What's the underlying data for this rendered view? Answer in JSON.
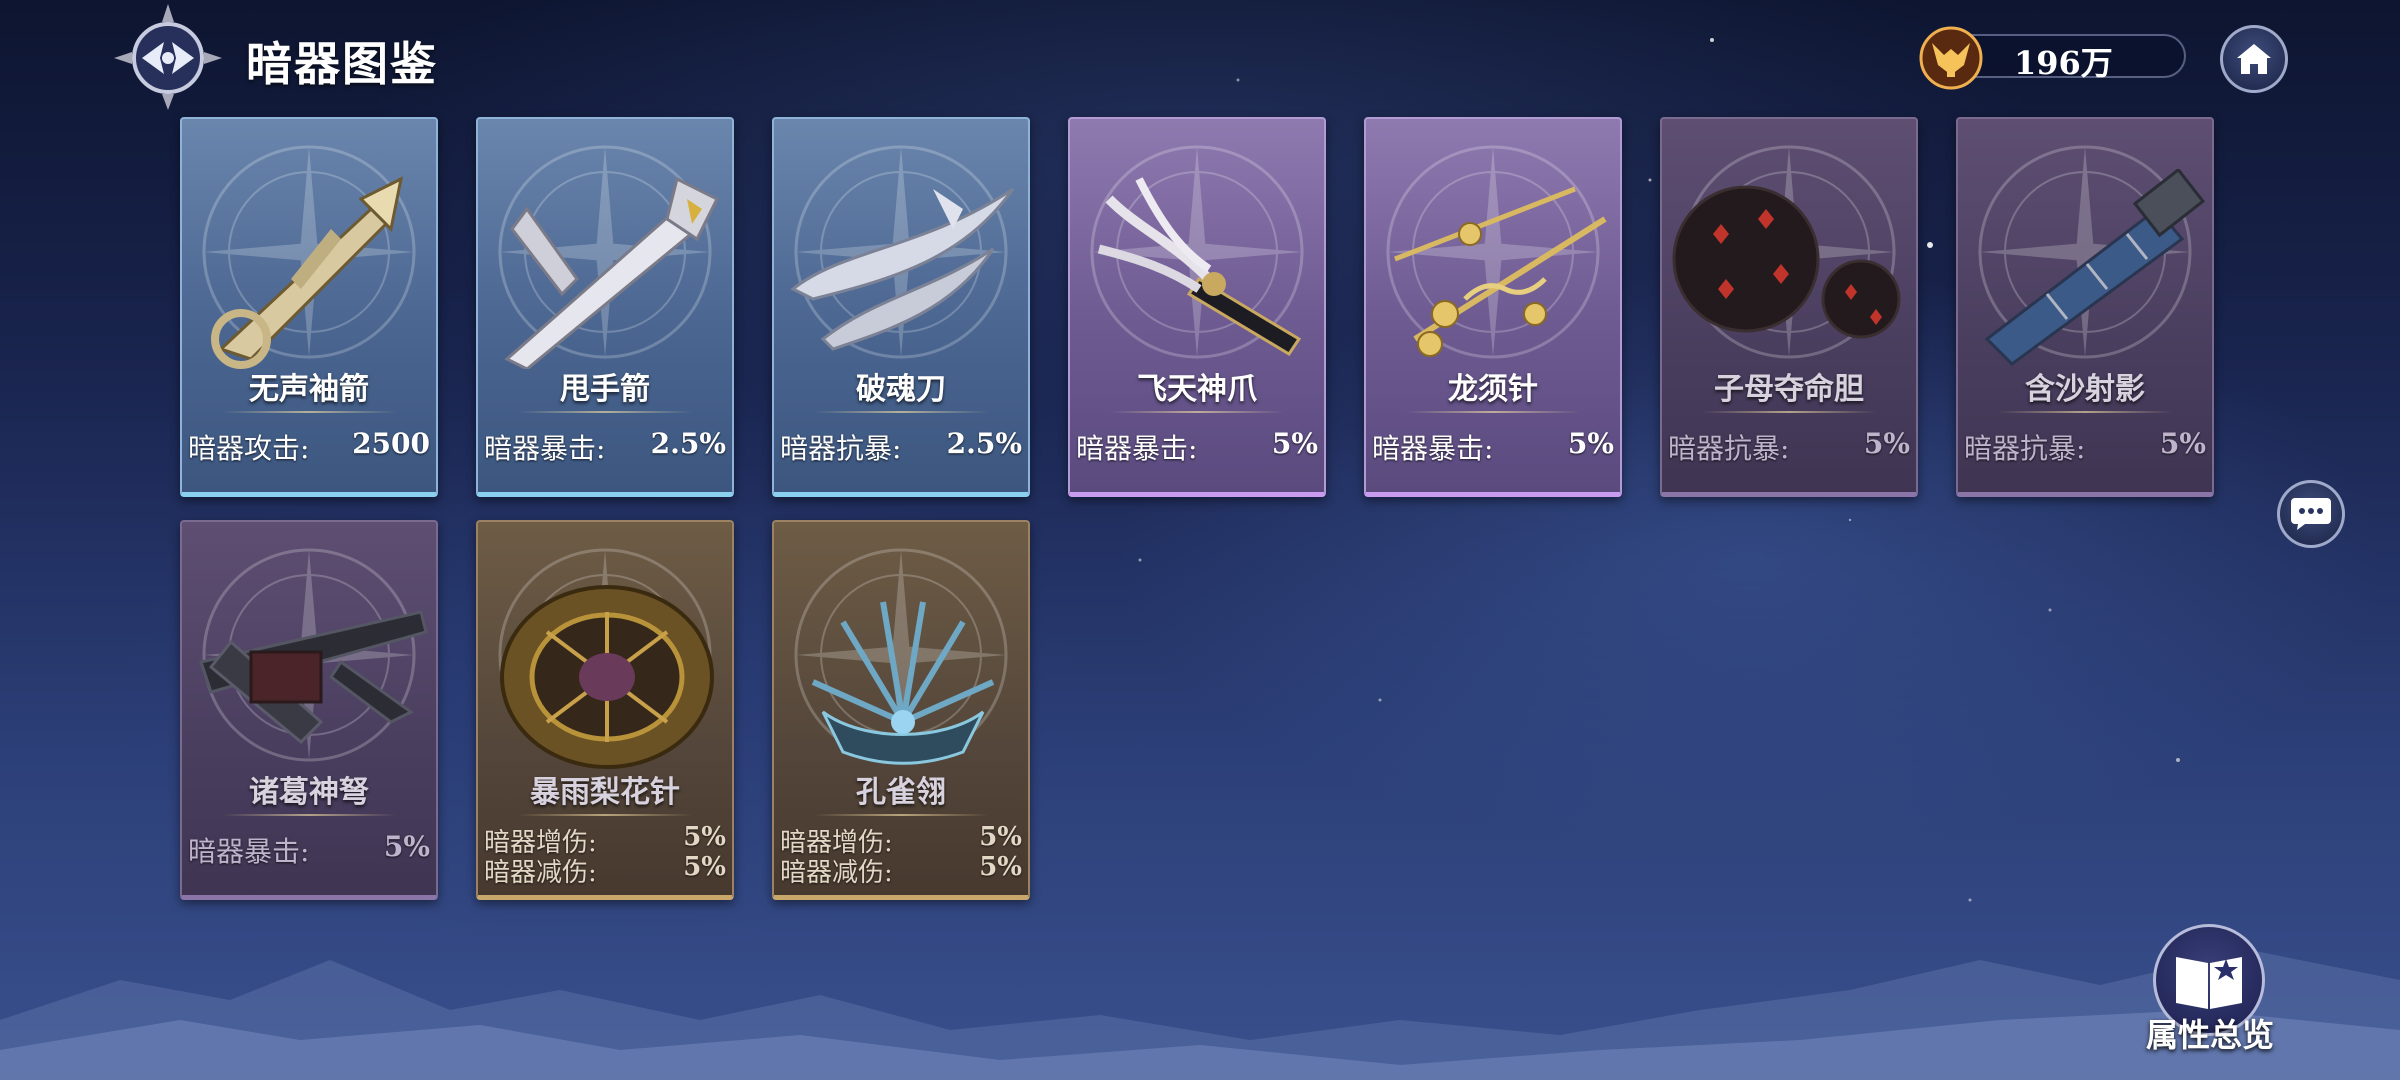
{
  "header": {
    "title": "暗器图鉴",
    "currency_value": "196万"
  },
  "cards": [
    {
      "name": "无声袖箭",
      "stats": [
        {
          "label": "暗器攻击:",
          "value": "2500"
        }
      ],
      "rarity": "blue"
    },
    {
      "name": "甩手箭",
      "stats": [
        {
          "label": "暗器暴击:",
          "value": "2.5%"
        }
      ],
      "rarity": "blue"
    },
    {
      "name": "破魂刀",
      "stats": [
        {
          "label": "暗器抗暴:",
          "value": "2.5%"
        }
      ],
      "rarity": "blue"
    },
    {
      "name": "飞天神爪",
      "stats": [
        {
          "label": "暗器暴击:",
          "value": "5%"
        }
      ],
      "rarity": "purple"
    },
    {
      "name": "龙须针",
      "stats": [
        {
          "label": "暗器暴击:",
          "value": "5%"
        }
      ],
      "rarity": "purple"
    },
    {
      "name": "子母夺命胆",
      "stats": [
        {
          "label": "暗器抗暴:",
          "value": "5%"
        }
      ],
      "rarity": "dim"
    },
    {
      "name": "含沙射影",
      "stats": [
        {
          "label": "暗器抗暴:",
          "value": "5%"
        }
      ],
      "rarity": "dim"
    },
    {
      "name": "诸葛神弩",
      "stats": [
        {
          "label": "暗器暴击:",
          "value": "5%"
        }
      ],
      "rarity": "dim"
    },
    {
      "name": "暴雨梨花针",
      "stats": [
        {
          "label": "暗器增伤:",
          "value": "5%"
        },
        {
          "label": "暗器减伤:",
          "value": "5%"
        }
      ],
      "rarity": "bronze"
    },
    {
      "name": "孔雀翎",
      "stats": [
        {
          "label": "暗器增伤:",
          "value": "5%"
        },
        {
          "label": "暗器减伤:",
          "value": "5%"
        }
      ],
      "rarity": "bronze"
    }
  ],
  "overview": {
    "label": "属性总览"
  },
  "icons": {
    "logo": "compass-emblem-icon",
    "currency": "horned-helmet-icon",
    "home": "home-icon",
    "chat": "chat-bubble-icon",
    "overview": "book-star-icon"
  },
  "colors": {
    "blue_rarity": "#8ad0f0",
    "purple_rarity": "#c99cf0",
    "bronze_rarity": "#c9a66a"
  }
}
